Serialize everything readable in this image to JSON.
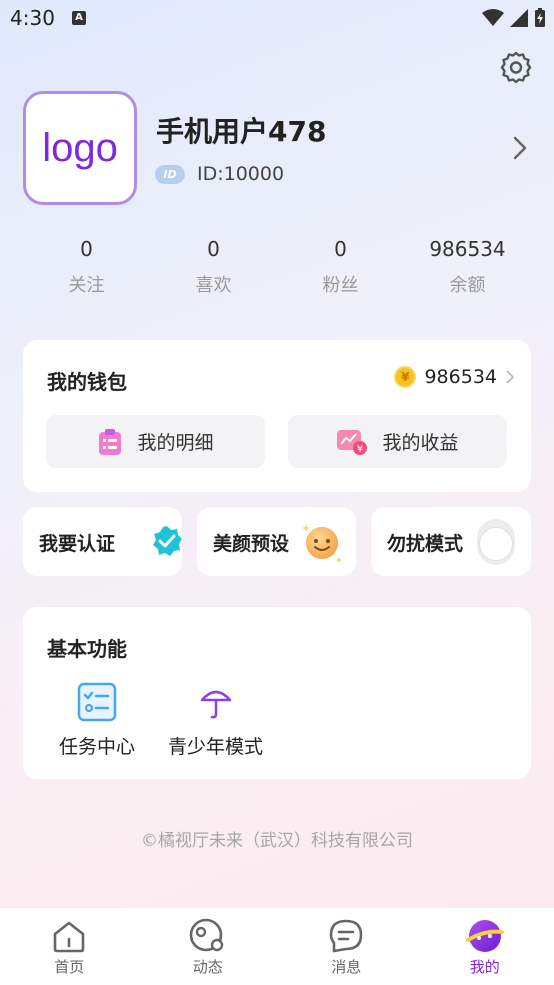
{
  "status_bar": {
    "time": "4:30",
    "notif_letter": "A"
  },
  "profile": {
    "avatar_text": "logo",
    "username": "手机用户478",
    "id_badge": "ID",
    "id_text": "ID:10000"
  },
  "stats": [
    {
      "value": "0",
      "label": "关注"
    },
    {
      "value": "0",
      "label": "喜欢"
    },
    {
      "value": "0",
      "label": "粉丝"
    },
    {
      "value": "986534",
      "label": "余额"
    }
  ],
  "wallet": {
    "title": "我的钱包",
    "coin_symbol": "¥",
    "balance": "986534",
    "details_label": "我的明细",
    "earnings_label": "我的收益"
  },
  "quick_actions": {
    "verify_label": "我要认证",
    "beauty_label": "美颜预设",
    "dnd_label": "勿扰模式"
  },
  "basic_functions": {
    "title": "基本功能",
    "items": [
      {
        "label": "任务中心",
        "icon": "task-list-icon"
      },
      {
        "label": "青少年模式",
        "icon": "umbrella-icon"
      }
    ]
  },
  "copyright": "©橘视厅未来（武汉）科技有限公司",
  "bottom_nav": [
    {
      "label": "首页",
      "icon": "home-icon"
    },
    {
      "label": "动态",
      "icon": "moments-icon"
    },
    {
      "label": "消息",
      "icon": "message-icon"
    },
    {
      "label": "我的",
      "icon": "profile-planet-icon",
      "active": true
    }
  ],
  "colors": {
    "accent": "#7d2be0",
    "avatar_border": "#b48be6",
    "verify": "#1ec3d6",
    "coin": "#f6c21a"
  }
}
